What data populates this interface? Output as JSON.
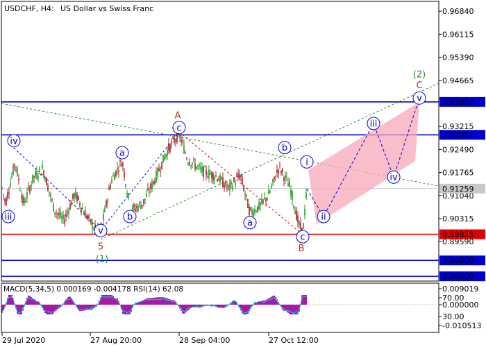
{
  "header": {
    "symbol_tf": "USDCHF, H4:",
    "description": "US Dollar vs Swiss Franc"
  },
  "indicator": {
    "label": "MACD(5,34,5) 0.000169 -0.004178 RSI(14) 62.08",
    "ticks": [
      "0.009019",
      "70.00",
      "0.000000",
      "30.00",
      "-0.010513"
    ],
    "histogram_color": "#a0009a",
    "rsi_color": "#00d8ff"
  },
  "chart_data": {
    "type": "candlestick",
    "symbol": "USDCHF",
    "timeframe": "H4",
    "price_axis": {
      "ylim": [
        0.8835,
        0.9715
      ],
      "ticks": [
        "0.96840",
        "0.96115",
        "0.95390",
        "0.94665",
        "0.93215",
        "0.92490",
        "0.91765",
        "0.91040",
        "0.90315",
        "0.89590"
      ]
    },
    "time_axis": {
      "labels": [
        "29 Jul 2020",
        "27 Aug 20:00",
        "28 Sep 04:00",
        "27 Oct 12:00"
      ]
    },
    "current_price": 0.91259,
    "levels": [
      {
        "value": 0.93987,
        "label": "0.93987",
        "color": "#0000d0"
      },
      {
        "value": 0.92951,
        "label": "0.92951",
        "color": "#0000d0"
      },
      {
        "value": 0.91259,
        "label": "0.91259",
        "color": "#c8c8c8"
      },
      {
        "value": 0.89823,
        "label": "0.89823",
        "color": "#e00000"
      },
      {
        "value": 0.89,
        "label": "0.89000",
        "color": "#0000d0"
      },
      {
        "value": 0.885,
        "label": "0.88500",
        "color": "#0000d0"
      }
    ],
    "price_path": [
      [
        0,
        0.9155
      ],
      [
        8,
        0.908
      ],
      [
        22,
        0.921
      ],
      [
        34,
        0.9075
      ],
      [
        48,
        0.916
      ],
      [
        62,
        0.919
      ],
      [
        78,
        0.906
      ],
      [
        92,
        0.9025
      ],
      [
        108,
        0.911
      ],
      [
        122,
        0.905
      ],
      [
        138,
        0.8995
      ],
      [
        146,
        0.9
      ],
      [
        160,
        0.915
      ],
      [
        176,
        0.9215
      ],
      [
        188,
        0.9055
      ],
      [
        206,
        0.908
      ],
      [
        222,
        0.915
      ],
      [
        242,
        0.925
      ],
      [
        258,
        0.9298
      ],
      [
        270,
        0.922
      ],
      [
        292,
        0.918
      ],
      [
        312,
        0.9165
      ],
      [
        330,
        0.9125
      ],
      [
        346,
        0.917
      ],
      [
        360,
        0.905
      ],
      [
        374,
        0.907
      ],
      [
        388,
        0.911
      ],
      [
        402,
        0.9195
      ],
      [
        418,
        0.913
      ],
      [
        430,
        0.9015
      ],
      [
        436,
        0.8986
      ],
      [
        440,
        0.9075
      ],
      [
        442,
        0.9126
      ]
    ],
    "wave_labels": [
      {
        "text": "iv",
        "x": 20,
        "price": 0.92765,
        "circled": true,
        "color": "#0000c8"
      },
      {
        "text": "iii",
        "x": 12,
        "price": 0.9038,
        "circled": true,
        "color": "#0000c8"
      },
      {
        "text": "v",
        "x": 145,
        "price": 0.8994,
        "circled": true,
        "color": "#0000c8"
      },
      {
        "text": "5",
        "x": 145,
        "price": 0.8944,
        "circled": false,
        "color": "#b03030"
      },
      {
        "text": "(1)",
        "x": 147,
        "price": 0.89045,
        "circled": false,
        "color": "#2a8a2a"
      },
      {
        "text": "a",
        "x": 176,
        "price": 0.9239,
        "circled": true,
        "color": "#0000c8"
      },
      {
        "text": "b",
        "x": 187,
        "price": 0.9038,
        "circled": true,
        "color": "#0000c8"
      },
      {
        "text": "c",
        "x": 258,
        "price": 0.9318,
        "circled": true,
        "color": "#0000c8"
      },
      {
        "text": "A",
        "x": 256,
        "price": 0.9357,
        "circled": false,
        "color": "#b03030"
      },
      {
        "text": "a",
        "x": 360,
        "price": 0.9019,
        "circled": true,
        "color": "#0000c8"
      },
      {
        "text": "b",
        "x": 410,
        "price": 0.9255,
        "circled": true,
        "color": "#0000c8"
      },
      {
        "text": "c",
        "x": 436,
        "price": 0.89745,
        "circled": true,
        "color": "#0000c8"
      },
      {
        "text": "B",
        "x": 434,
        "price": 0.8939,
        "circled": false,
        "color": "#b03030"
      },
      {
        "text": "i",
        "x": 442,
        "price": 0.921,
        "circled": true,
        "color": "#0000c8"
      },
      {
        "text": "ii",
        "x": 466,
        "price": 0.9038,
        "circled": true,
        "color": "#0000c8"
      },
      {
        "text": "iii",
        "x": 538,
        "price": 0.9331,
        "circled": true,
        "color": "#0000c8"
      },
      {
        "text": "iv",
        "x": 567,
        "price": 0.9162,
        "circled": true,
        "color": "#0000c8"
      },
      {
        "text": "v",
        "x": 604,
        "price": 0.9411,
        "circled": true,
        "color": "#0000c8"
      },
      {
        "text": "C",
        "x": 604,
        "price": 0.9452,
        "circled": false,
        "color": "#b03030"
      },
      {
        "text": "(2)",
        "x": 604,
        "price": 0.9486,
        "circled": false,
        "color": "#2a8a2a"
      }
    ],
    "forecast_path": [
      [
        442,
        0.9125
      ],
      [
        466,
        0.9038
      ],
      [
        538,
        0.9331
      ],
      [
        567,
        0.9162
      ],
      [
        604,
        0.9411
      ]
    ]
  }
}
